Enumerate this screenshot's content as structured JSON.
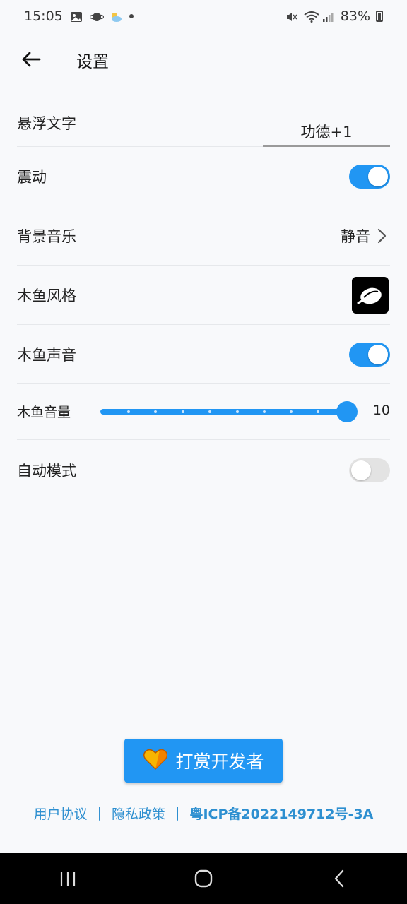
{
  "status_bar": {
    "time": "15:05",
    "battery": "83%",
    "icons_left": [
      "gallery-icon",
      "planet-icon",
      "weather-icon",
      "dot-icon"
    ],
    "icons_right": [
      "mute-icon",
      "wifi-icon",
      "signal-icon",
      "battery-icon"
    ]
  },
  "header": {
    "back_icon": "back-arrow-icon",
    "title": "设置"
  },
  "settings": {
    "float_text": {
      "label": "悬浮文字",
      "value": "功德+1"
    },
    "vibration": {
      "label": "震动",
      "enabled": true
    },
    "bg_music": {
      "label": "背景音乐",
      "value": "静音",
      "icon": "chevron-right-icon"
    },
    "fish_style": {
      "label": "木鱼风格",
      "icon": "wooden-fish-icon"
    },
    "fish_sound": {
      "label": "木鱼声音",
      "enabled": true
    },
    "fish_volume": {
      "label": "木鱼音量",
      "value": "10",
      "level": 1.0
    },
    "auto_mode": {
      "label": "自动模式",
      "enabled": false
    }
  },
  "donate": {
    "label": "打赏开发者",
    "icon": "heart-icon"
  },
  "footer": {
    "user_agreement": "用户协议",
    "separator": "|",
    "privacy_policy": "隐私政策",
    "icp": "粤ICP备2022149712号-3A"
  },
  "nav_bar": {
    "items": [
      "recent-apps-icon",
      "home-icon",
      "back-icon"
    ]
  },
  "colors": {
    "accent": "#2196f3",
    "link": "#2d8fd0",
    "background": "#f8f9fb"
  }
}
